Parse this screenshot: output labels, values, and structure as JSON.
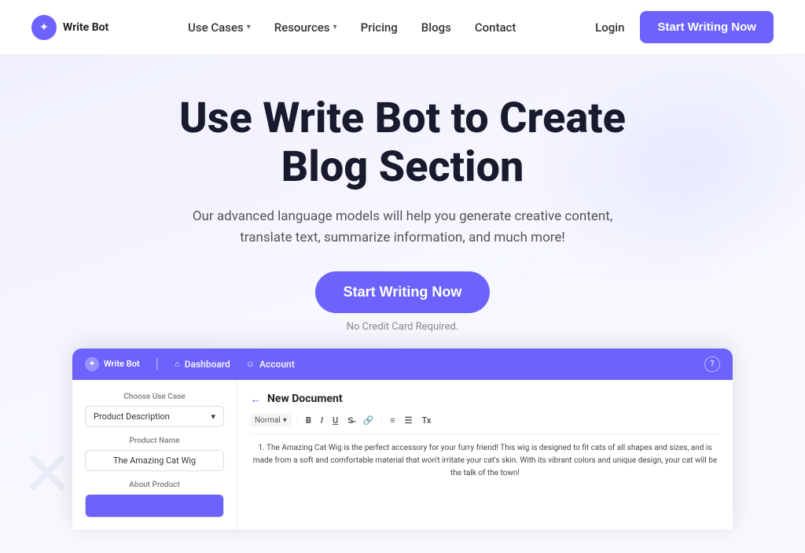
{
  "brand": {
    "name": "Write Bot",
    "logo_symbol": "✦"
  },
  "navbar": {
    "use_cases_label": "Use Cases",
    "resources_label": "Resources",
    "pricing_label": "Pricing",
    "blogs_label": "Blogs",
    "contact_label": "Contact",
    "login_label": "Login",
    "cta_label": "Start Writing Now"
  },
  "hero": {
    "title_line1": "Use Write Bot to Create",
    "title_line2": "Blog Section",
    "subtitle": "Our advanced language models will help you generate creative content, translate text, summarize information, and much more!",
    "cta_label": "Start Writing Now",
    "no_card_text": "No Credit Card Required."
  },
  "dashboard": {
    "logo": "Write Bot",
    "nav_dashboard": "Dashboard",
    "nav_account": "Account",
    "new_document_title": "New Document",
    "choose_use_case_label": "Choose Use Case",
    "use_case_value": "Product Description",
    "product_name_label": "Product Name",
    "product_name_value": "The Amazing Cat Wig",
    "about_product_label": "About Product",
    "toolbar_style": "Normal",
    "content_text": "1. The Amazing Cat Wig is the perfect accessory for your furry friend! This wig is designed to fit cats of all shapes and sizes, and is made from a soft and comfortable material that won't irritate your cat's skin. With its vibrant colors and unique design, your cat will be the talk of the town!"
  }
}
